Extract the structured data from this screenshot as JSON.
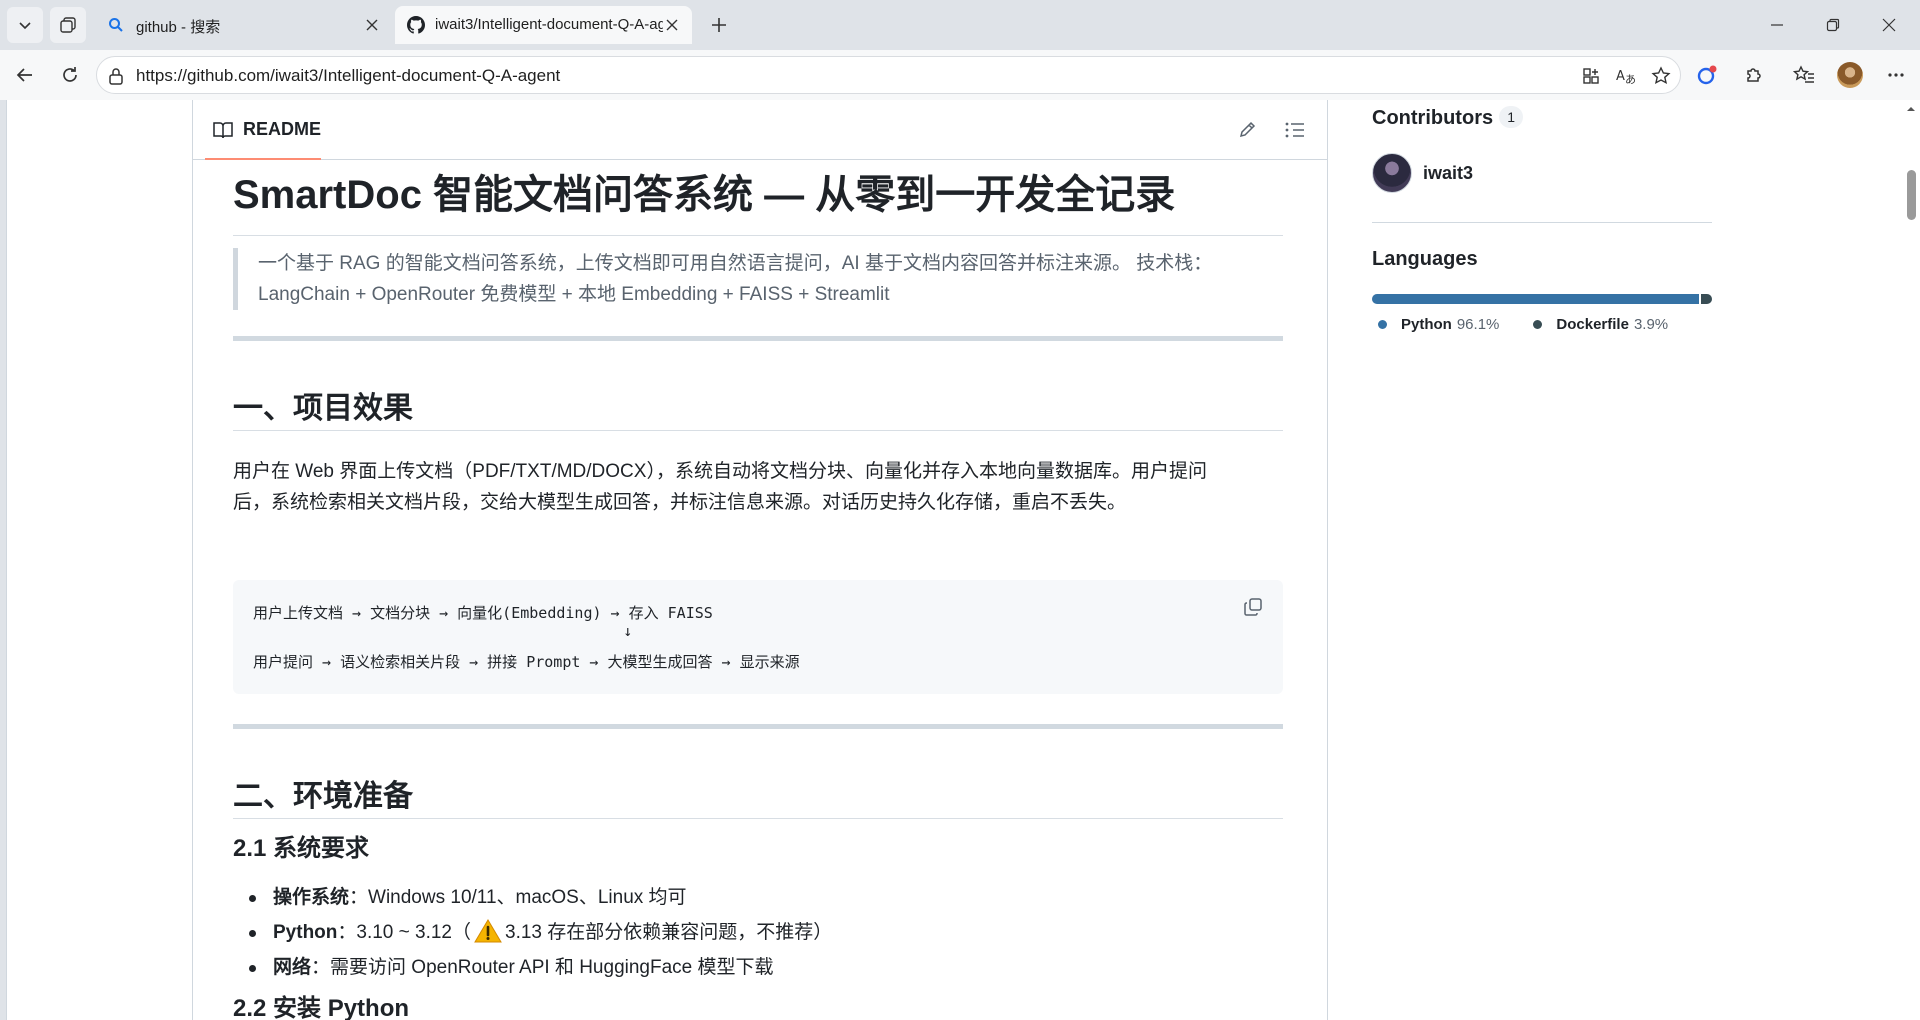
{
  "browser": {
    "tabs": [
      {
        "title": "github - 搜索",
        "icon": "search-icon",
        "active": false
      },
      {
        "title": "iwait3/Intelligent-document-Q-A-agent",
        "icon": "github-icon",
        "active": true
      }
    ],
    "url": "https://github.com/iwait3/Intelligent-document-Q-A-agent"
  },
  "readme": {
    "tab_label": "README",
    "title": "SmartDoc 智能文档问答系统 — 从零到一开发全记录",
    "quote_line1": "一个基于 RAG 的智能文档问答系统，上传文档即可用自然语言提问，AI 基于文档内容回答并标注来源。 技术栈：",
    "quote_line2": "LangChain + OpenRouter 免费模型 + 本地 Embedding + FAISS + Streamlit",
    "section1_title": "一、项目效果",
    "section1_para1": "用户在 Web 界面上传文档（PDF/TXT/MD/DOCX），系统自动将文档分块、向量化并存入本地向量数据库。用户提问",
    "section1_para2": "后，系统检索相关文档片段，交给大模型生成回答，并标注信息来源。对话历史持久化存储，重启不丢失。",
    "code_line1": "用户上传文档 → 文档分块 → 向量化(Embedding) → 存入 FAISS",
    "code_line2": "                                         ↓",
    "code_line3": "用户提问 → 语义检索相关片段 → 拼接 Prompt → 大模型生成回答 → 显示来源",
    "section2_title": "二、环境准备",
    "sub21_title": "2.1 系统要求",
    "req": [
      {
        "label": "操作系统",
        "text": "：Windows 10/11、macOS、Linux 均可"
      },
      {
        "label": "Python",
        "text_before": "：3.10 ~ 3.12（",
        "text_after": "3.13 存在部分依赖兼容问题，不推荐）"
      },
      {
        "label": "网络",
        "text": "：需要访问 OpenRouter API 和 HuggingFace 模型下载"
      }
    ],
    "sub22_title": "2.2 安装 Python"
  },
  "sidebar": {
    "contributors_title": "Contributors",
    "contributors_count": "1",
    "contributor_name": "iwait3",
    "languages_title": "Languages",
    "languages": [
      {
        "name": "Python",
        "pct": "96.1%",
        "value": 96.1,
        "color": "#3572A5"
      },
      {
        "name": "Dockerfile",
        "pct": "3.9%",
        "value": 3.9,
        "color": "#384d54"
      }
    ]
  }
}
